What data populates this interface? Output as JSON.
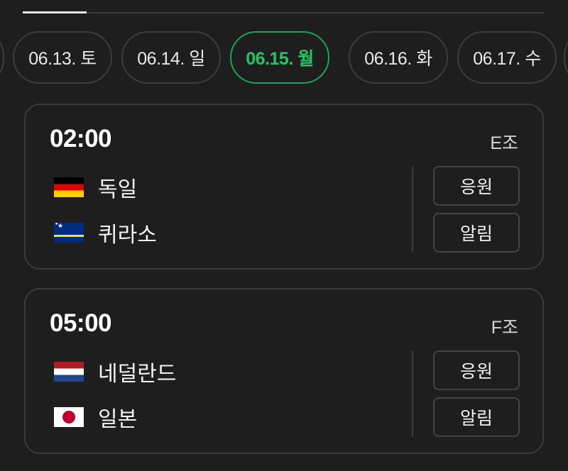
{
  "dates": [
    {
      "label": "06.13. 토",
      "active": false
    },
    {
      "label": "06.14. 일",
      "active": false
    },
    {
      "label": "06.15. 월",
      "active": true
    },
    {
      "label": "06.16. 화",
      "active": false
    },
    {
      "label": "06.17. 수",
      "active": false
    }
  ],
  "matches": [
    {
      "time": "02:00",
      "group": "E조",
      "home": {
        "name": "독일",
        "flag": "germany-flag-icon"
      },
      "away": {
        "name": "퀴라소",
        "flag": "curacao-flag-icon"
      },
      "cheer_label": "응원",
      "alarm_label": "알림"
    },
    {
      "time": "05:00",
      "group": "F조",
      "home": {
        "name": "네덜란드",
        "flag": "netherlands-flag-icon"
      },
      "away": {
        "name": "일본",
        "flag": "japan-flag-icon"
      },
      "cheer_label": "응원",
      "alarm_label": "알림"
    }
  ],
  "colors": {
    "background": "#1e1e1e",
    "accent": "#27c26a",
    "border": "#3a3a3a"
  }
}
